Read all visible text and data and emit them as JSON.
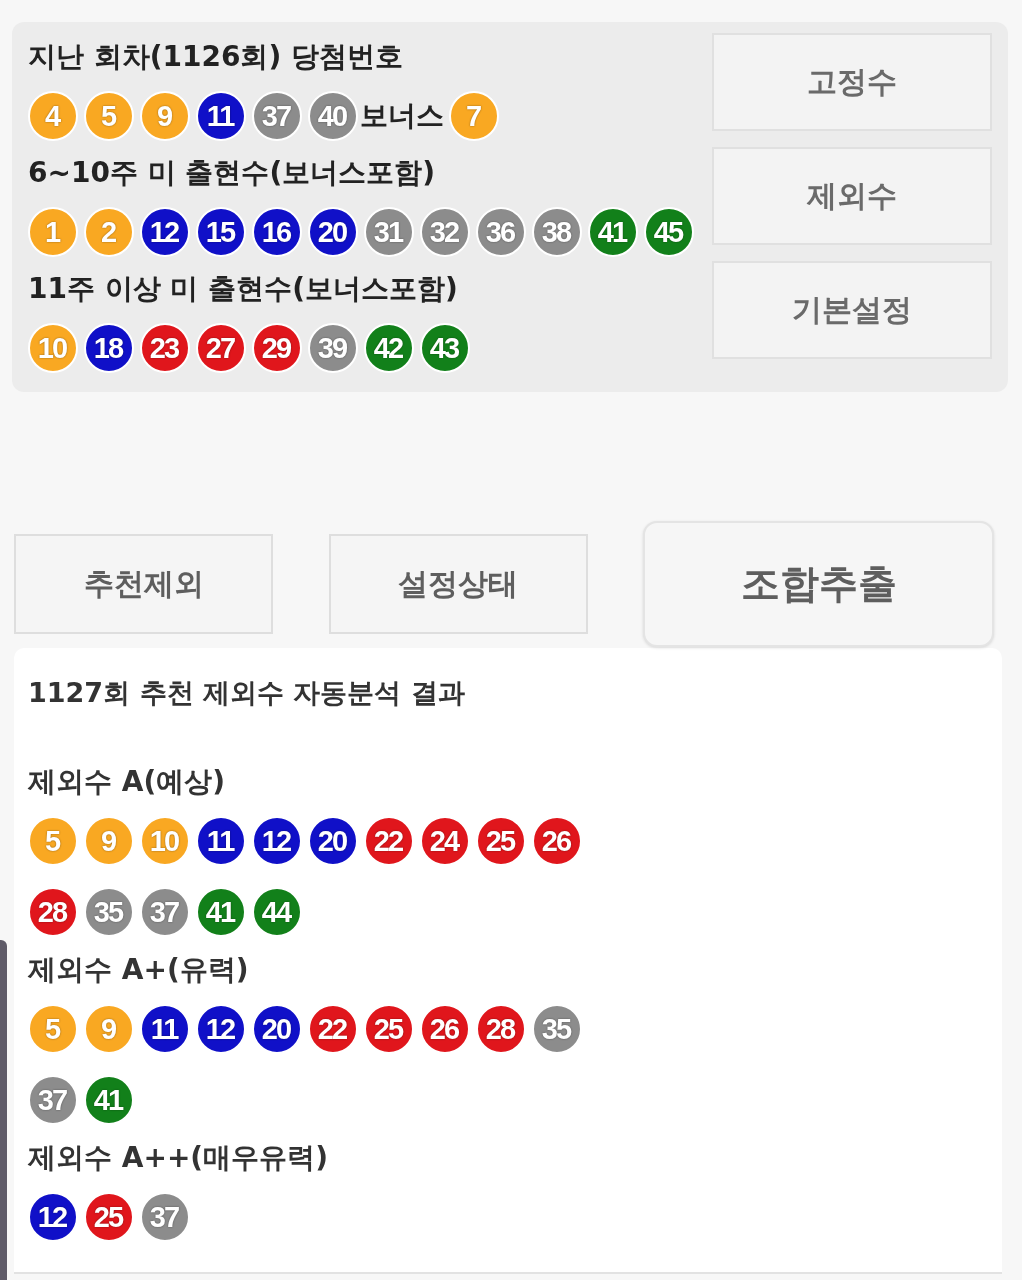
{
  "draw_panel": {
    "sections": [
      {
        "title": "지난 회차(1126회) 당첨번호",
        "balls": [
          {
            "number": "4",
            "color": "#f9a822"
          },
          {
            "number": "5",
            "color": "#f9a822"
          },
          {
            "number": "9",
            "color": "#f9a822"
          },
          {
            "number": "11",
            "color": "#1010c8"
          },
          {
            "number": "37",
            "color": "#8c8c8c"
          },
          {
            "number": "40",
            "color": "#8c8c8c"
          }
        ],
        "bonus": {
          "label": "보너스",
          "ball": {
            "number": "7",
            "color": "#f9a822"
          }
        }
      },
      {
        "title": "6~10주 미 출현수(보너스포함)",
        "balls": [
          {
            "number": "1",
            "color": "#f9a822"
          },
          {
            "number": "2",
            "color": "#f9a822"
          },
          {
            "number": "12",
            "color": "#1010c8"
          },
          {
            "number": "15",
            "color": "#1010c8"
          },
          {
            "number": "16",
            "color": "#1010c8"
          },
          {
            "number": "20",
            "color": "#1010c8"
          },
          {
            "number": "31",
            "color": "#8c8c8c"
          },
          {
            "number": "32",
            "color": "#8c8c8c"
          },
          {
            "number": "36",
            "color": "#8c8c8c"
          },
          {
            "number": "38",
            "color": "#8c8c8c"
          },
          {
            "number": "41",
            "color": "#12801a"
          },
          {
            "number": "45",
            "color": "#12801a"
          }
        ]
      },
      {
        "title": "11주 이상 미 출현수(보너스포함)",
        "balls": [
          {
            "number": "10",
            "color": "#f9a822"
          },
          {
            "number": "18",
            "color": "#1010c8"
          },
          {
            "number": "23",
            "color": "#e0161c"
          },
          {
            "number": "27",
            "color": "#e0161c"
          },
          {
            "number": "29",
            "color": "#e0161c"
          },
          {
            "number": "39",
            "color": "#8c8c8c"
          },
          {
            "number": "42",
            "color": "#12801a"
          },
          {
            "number": "43",
            "color": "#12801a"
          }
        ]
      }
    ],
    "side_buttons": [
      "고정수",
      "제외수",
      "기본설정"
    ]
  },
  "action_buttons": [
    {
      "label": "추천제외",
      "kind": "plain"
    },
    {
      "label": "설정상태",
      "kind": "plain"
    },
    {
      "label": "조합추출",
      "kind": "primary"
    }
  ],
  "analysis": {
    "title": "1127회 추천 제외수 자동분석 결과",
    "groups": [
      {
        "label": "제외수 A(예상)",
        "balls": [
          {
            "number": "5",
            "color": "#f9a822"
          },
          {
            "number": "9",
            "color": "#f9a822"
          },
          {
            "number": "10",
            "color": "#f9a822"
          },
          {
            "number": "11",
            "color": "#1010c8"
          },
          {
            "number": "12",
            "color": "#1010c8"
          },
          {
            "number": "20",
            "color": "#1010c8"
          },
          {
            "number": "22",
            "color": "#e0161c"
          },
          {
            "number": "24",
            "color": "#e0161c"
          },
          {
            "number": "25",
            "color": "#e0161c"
          },
          {
            "number": "26",
            "color": "#e0161c"
          },
          {
            "number": "28",
            "color": "#e0161c"
          },
          {
            "number": "35",
            "color": "#8c8c8c"
          },
          {
            "number": "37",
            "color": "#8c8c8c"
          },
          {
            "number": "41",
            "color": "#12801a"
          },
          {
            "number": "44",
            "color": "#12801a"
          }
        ]
      },
      {
        "label": "제외수 A+(유력)",
        "balls": [
          {
            "number": "5",
            "color": "#f9a822"
          },
          {
            "number": "9",
            "color": "#f9a822"
          },
          {
            "number": "11",
            "color": "#1010c8"
          },
          {
            "number": "12",
            "color": "#1010c8"
          },
          {
            "number": "20",
            "color": "#1010c8"
          },
          {
            "number": "22",
            "color": "#e0161c"
          },
          {
            "number": "25",
            "color": "#e0161c"
          },
          {
            "number": "26",
            "color": "#e0161c"
          },
          {
            "number": "28",
            "color": "#e0161c"
          },
          {
            "number": "35",
            "color": "#8c8c8c"
          },
          {
            "number": "37",
            "color": "#8c8c8c"
          },
          {
            "number": "41",
            "color": "#12801a"
          }
        ]
      },
      {
        "label": "제외수 A++(매우유력)",
        "balls": [
          {
            "number": "12",
            "color": "#1010c8"
          },
          {
            "number": "25",
            "color": "#e0161c"
          },
          {
            "number": "37",
            "color": "#8c8c8c"
          }
        ]
      }
    ]
  }
}
